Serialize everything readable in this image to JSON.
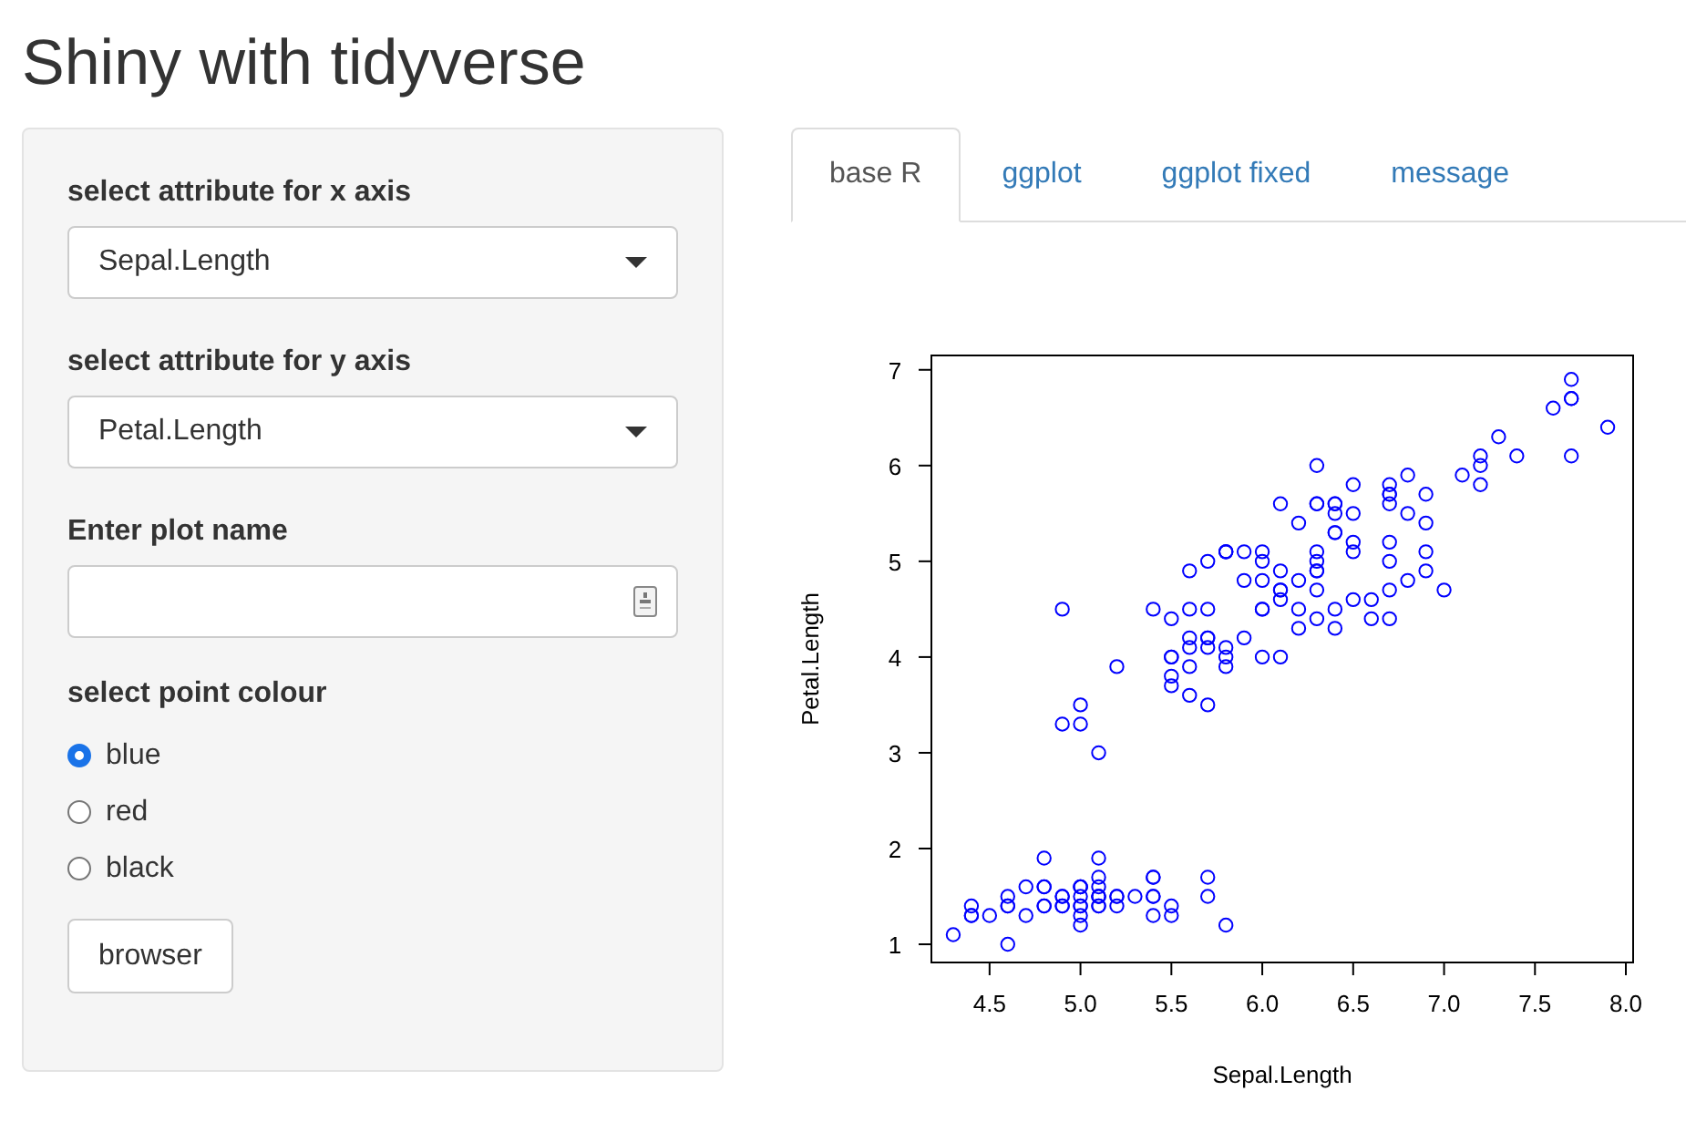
{
  "title": "Shiny with tidyverse",
  "sidebar": {
    "x_select": {
      "label": "select attribute for x axis",
      "value": "Sepal.Length"
    },
    "y_select": {
      "label": "select attribute for y axis",
      "value": "Petal.Length"
    },
    "plot_name": {
      "label": "Enter plot name"
    },
    "colour": {
      "label": "select point colour",
      "options": [
        {
          "label": "blue",
          "selected": true
        },
        {
          "label": "red",
          "selected": false
        },
        {
          "label": "black",
          "selected": false
        }
      ]
    },
    "button": "browser"
  },
  "tabs": [
    {
      "label": "base R",
      "selected": true
    },
    {
      "label": "ggplot",
      "selected": false
    },
    {
      "label": "ggplot fixed",
      "selected": false
    },
    {
      "label": "message",
      "selected": false
    }
  ],
  "plot": {
    "chart_data": {
      "type": "scatter",
      "xlabel": "Sepal.Length",
      "ylabel": "Petal.Length",
      "xlim": [
        4.18,
        8.04
      ],
      "ylim": [
        0.81,
        7.15
      ],
      "xticks": [
        {
          "value": 4.5,
          "label": "4.5"
        },
        {
          "value": 5,
          "label": "5.0"
        },
        {
          "value": 5.5,
          "label": "5.5"
        },
        {
          "value": 6,
          "label": "6.0"
        },
        {
          "value": 6.5,
          "label": "6.5"
        },
        {
          "value": 7,
          "label": "7.0"
        },
        {
          "value": 7.5,
          "label": "7.5"
        },
        {
          "value": 8,
          "label": "8.0"
        }
      ],
      "yticks": [
        1,
        2,
        3,
        4,
        5,
        6,
        7
      ],
      "x": [
        5.1,
        4.9,
        4.7,
        4.6,
        5.0,
        5.4,
        4.6,
        5.0,
        4.4,
        4.9,
        5.4,
        4.8,
        4.8,
        4.3,
        5.8,
        5.7,
        5.4,
        5.1,
        5.7,
        5.1,
        5.4,
        5.1,
        4.6,
        5.1,
        4.8,
        5.0,
        5.0,
        5.2,
        5.2,
        4.7,
        4.8,
        5.4,
        5.2,
        5.5,
        4.9,
        5.0,
        5.5,
        4.9,
        4.4,
        5.1,
        5.0,
        4.5,
        4.4,
        5.0,
        5.1,
        4.8,
        5.1,
        4.6,
        5.3,
        5.0,
        7.0,
        6.4,
        6.9,
        5.5,
        6.5,
        5.7,
        6.3,
        4.9,
        6.6,
        5.2,
        5.0,
        5.9,
        6.0,
        6.1,
        5.6,
        6.7,
        5.6,
        5.8,
        6.2,
        5.6,
        5.9,
        6.1,
        6.3,
        6.1,
        6.4,
        6.6,
        6.8,
        6.7,
        6.0,
        5.7,
        5.5,
        5.5,
        5.8,
        6.0,
        5.4,
        6.0,
        6.7,
        6.3,
        5.6,
        5.5,
        5.5,
        6.1,
        5.8,
        5.0,
        5.6,
        5.7,
        5.7,
        6.2,
        5.1,
        5.7,
        6.3,
        5.8,
        7.1,
        6.3,
        6.5,
        7.6,
        4.9,
        7.3,
        6.7,
        7.2,
        6.5,
        6.4,
        6.8,
        5.7,
        5.8,
        6.4,
        6.5,
        7.7,
        7.7,
        6.0,
        6.9,
        5.6,
        7.7,
        6.3,
        6.7,
        7.2,
        6.2,
        6.1,
        6.4,
        7.2,
        7.4,
        7.9,
        6.4,
        6.3,
        6.1,
        7.7,
        6.3,
        6.4,
        6.0,
        6.9,
        6.7,
        6.9,
        5.8,
        6.8,
        6.7,
        6.7,
        6.3,
        6.5,
        6.2,
        5.9
      ],
      "series": [
        {
          "color": "#0000ff",
          "values": [
            1.4,
            1.4,
            1.3,
            1.5,
            1.4,
            1.7,
            1.4,
            1.5,
            1.4,
            1.5,
            1.5,
            1.6,
            1.4,
            1.1,
            1.2,
            1.5,
            1.3,
            1.4,
            1.7,
            1.5,
            1.7,
            1.5,
            1.0,
            1.7,
            1.9,
            1.6,
            1.6,
            1.5,
            1.4,
            1.6,
            1.6,
            1.5,
            1.5,
            1.4,
            1.5,
            1.2,
            1.3,
            1.4,
            1.3,
            1.5,
            1.3,
            1.3,
            1.3,
            1.6,
            1.9,
            1.4,
            1.6,
            1.4,
            1.5,
            1.4,
            4.7,
            4.5,
            4.9,
            4.0,
            4.6,
            4.5,
            4.7,
            3.3,
            4.6,
            3.9,
            3.5,
            4.2,
            4.0,
            4.7,
            3.6,
            4.4,
            4.5,
            4.1,
            4.5,
            3.9,
            4.8,
            4.0,
            4.9,
            4.7,
            4.3,
            4.4,
            4.8,
            5.0,
            4.5,
            3.5,
            3.8,
            3.7,
            3.9,
            5.1,
            4.5,
            4.5,
            4.7,
            4.4,
            4.1,
            4.0,
            4.4,
            4.6,
            4.0,
            3.3,
            4.2,
            4.2,
            4.2,
            4.3,
            3.0,
            4.1,
            6.0,
            5.1,
            5.9,
            5.6,
            5.8,
            6.6,
            4.5,
            6.3,
            5.8,
            6.1,
            5.1,
            5.3,
            5.5,
            5.0,
            5.1,
            5.3,
            5.5,
            6.7,
            6.9,
            5.0,
            5.7,
            4.9,
            6.7,
            4.9,
            5.7,
            6.0,
            4.8,
            4.9,
            5.6,
            5.8,
            6.1,
            6.4,
            5.6,
            5.1,
            5.6,
            6.1,
            5.6,
            5.5,
            4.8,
            5.4,
            5.6,
            5.1,
            5.1,
            5.9,
            5.7,
            5.2,
            5.0,
            5.2,
            5.4,
            5.1
          ]
        }
      ]
    }
  }
}
